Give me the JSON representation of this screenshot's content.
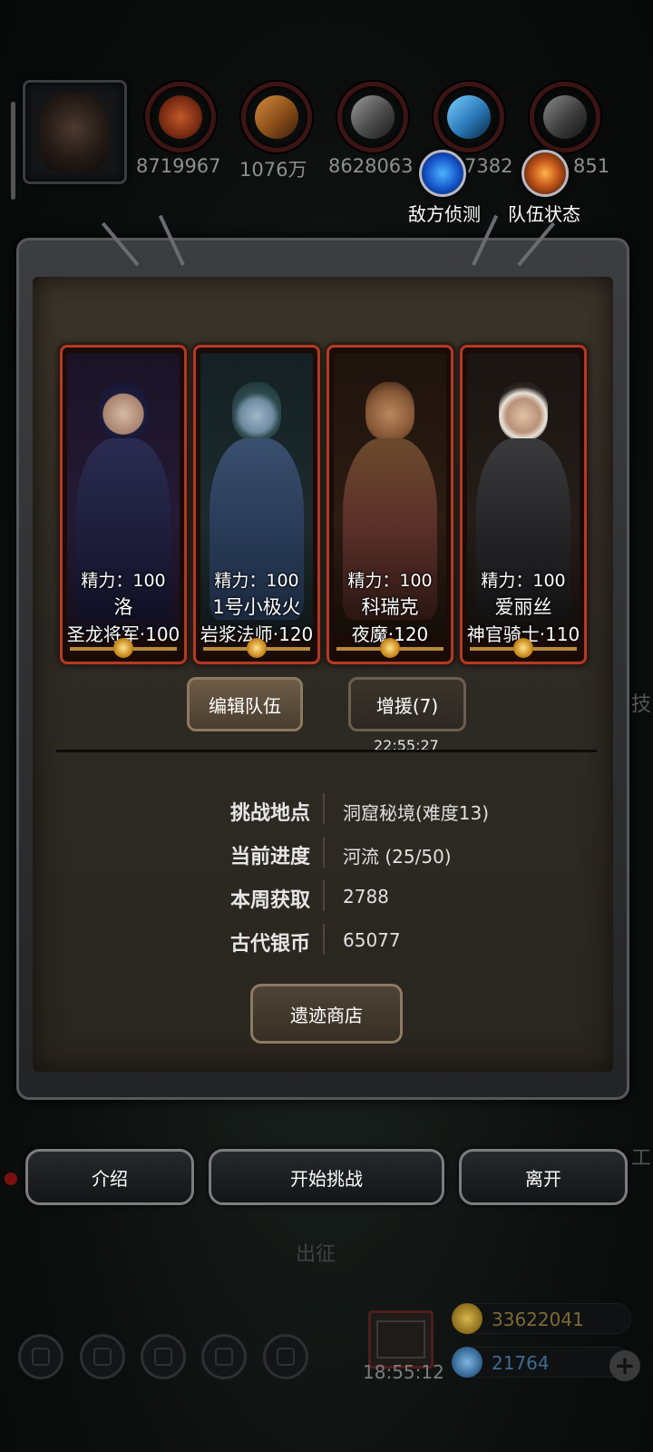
{
  "resources": [
    {
      "icon": "meat-icon",
      "value": "8719967"
    },
    {
      "icon": "wood-icon",
      "value": "1076万"
    },
    {
      "icon": "iron-icon",
      "value": "8628063"
    },
    {
      "icon": "crystal-icon",
      "value": "7382"
    },
    {
      "icon": "stone-icon",
      "value": "851"
    }
  ],
  "round_buttons": {
    "enemy_scout": "敌方侦测",
    "team_status": "队伍状态"
  },
  "heroes": [
    {
      "stamina": "精力：100",
      "name": "洛",
      "class": "圣龙将军·100"
    },
    {
      "stamina": "精力：100",
      "name": "1号小极火",
      "class": "岩浆法师·120"
    },
    {
      "stamina": "精力：100",
      "name": "科瑞克",
      "class": "夜魔·120"
    },
    {
      "stamina": "精力：100",
      "name": "爱丽丝",
      "class": "神官骑士·110"
    }
  ],
  "tabs": {
    "edit_team": "编辑队伍",
    "reinforce": "增援(7)",
    "reinforce_timer": "22:55:27"
  },
  "info": [
    {
      "key": "挑战地点",
      "value": "洞窟秘境(难度13)"
    },
    {
      "key": "当前进度",
      "value": "河流 (25/50)"
    },
    {
      "key": "本周获取",
      "value": "2788"
    },
    {
      "key": "古代银币",
      "value": "65077"
    }
  ],
  "shop_button": "遗迹商店",
  "actions": {
    "intro": "介绍",
    "start": "开始挑战",
    "leave": "离开"
  },
  "background": {
    "expedition_label": "出征",
    "edge_text_1": "技",
    "edge_text_2": "工"
  },
  "bottom": {
    "timer": "18:55:12",
    "gold": "33622041",
    "gems": "21764",
    "plus": "+"
  },
  "colors": {
    "card_border": "#b33a25",
    "gold_text": "#7b6a34",
    "gem_text": "#3f6b93"
  }
}
